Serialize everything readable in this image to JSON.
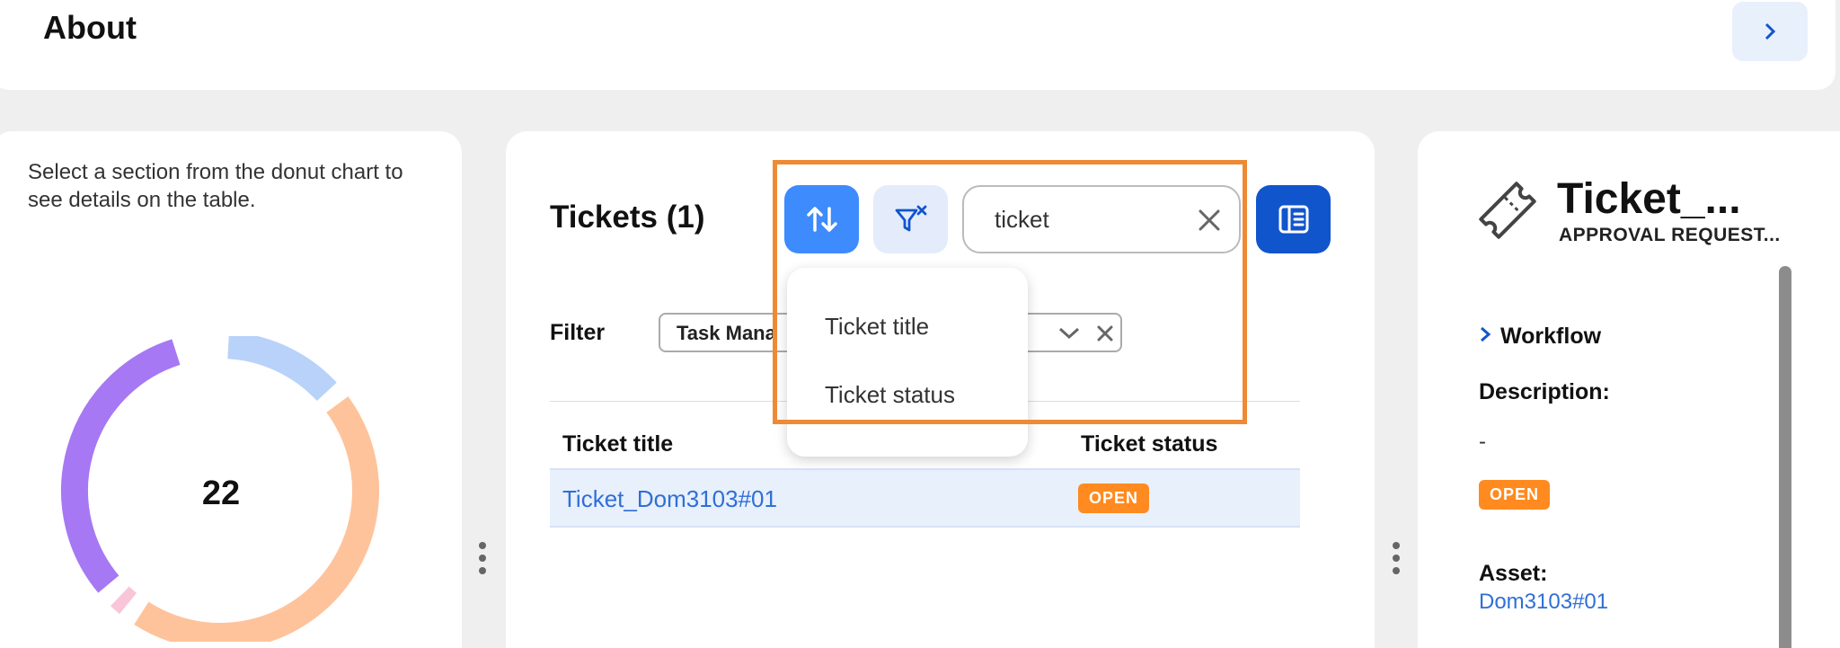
{
  "about": {
    "title": "About"
  },
  "donut_panel": {
    "hint": "Select a section from the donut chart to see details on the table.",
    "total": "22",
    "segments": [
      {
        "fraction": 0.14,
        "color": "#b8d2fa"
      },
      {
        "fraction": 0.46,
        "color": "#fec39b"
      },
      {
        "fraction": 0.03,
        "color": "#f8c6d8"
      },
      {
        "fraction": 0.33,
        "color": "#a678f3"
      }
    ]
  },
  "tickets": {
    "heading": "Tickets (1)",
    "search_value": "ticket",
    "filter_label": "Filter",
    "filter_chip": "Task Mana",
    "sort_menu": [
      "Ticket title",
      "Ticket status"
    ],
    "columns": {
      "title": "Ticket title",
      "status": "Ticket status"
    },
    "rows": [
      {
        "title": "Ticket_Dom3103#01",
        "status": "OPEN"
      }
    ]
  },
  "detail": {
    "title": "Ticket_...",
    "subtitle": "APPROVAL REQUEST...",
    "workflow": "Workflow",
    "description_label": "Description:",
    "description_value": "-",
    "status": "OPEN",
    "asset_label": "Asset:",
    "asset_value": "Dom3103#01"
  },
  "colors": {
    "accent": "#3d8bfd",
    "accent_dark": "#1155cc",
    "status_open": "#ff8a1f",
    "highlight": "#ee8a34"
  }
}
